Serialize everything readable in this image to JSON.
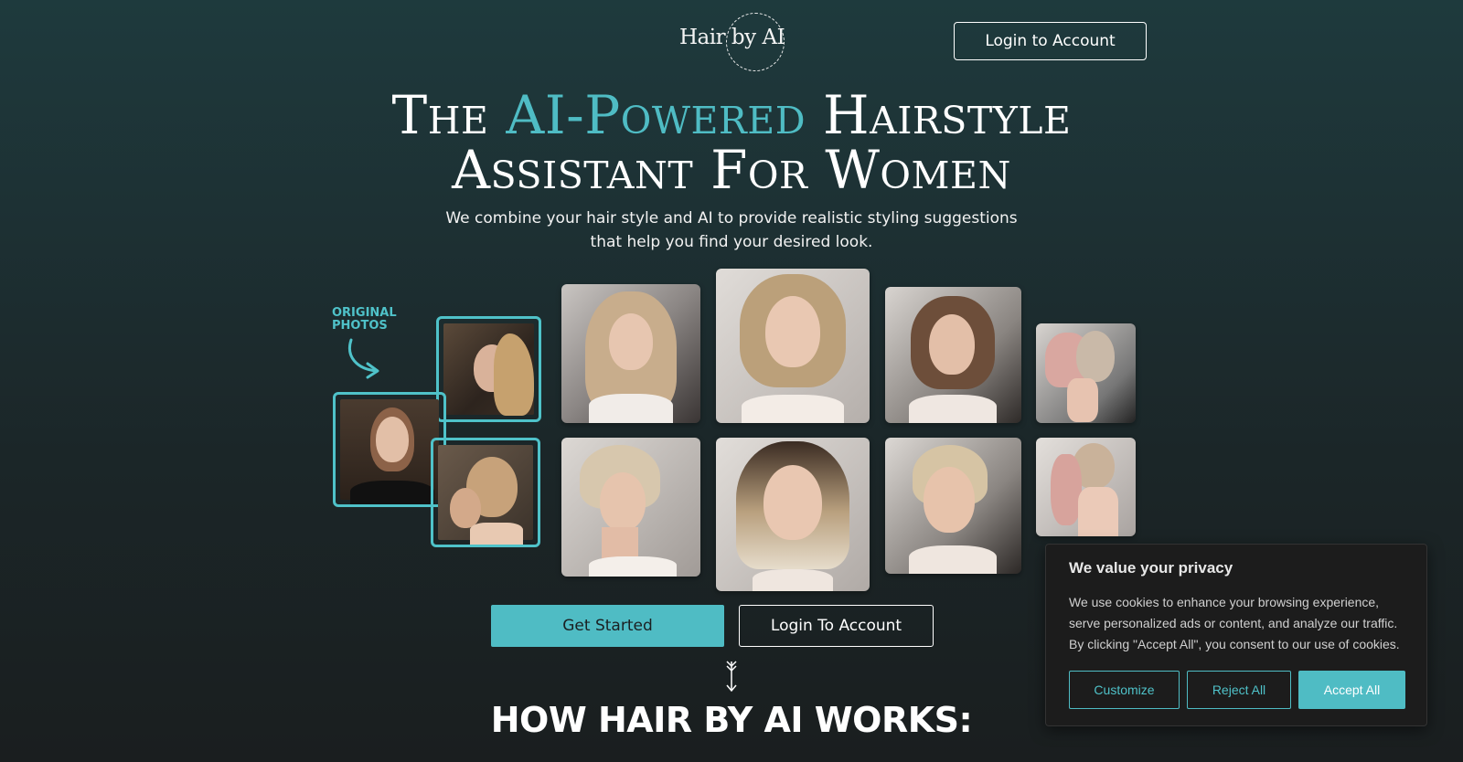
{
  "header": {
    "logo_text": "Hair by AI",
    "login_label": "Login to Account"
  },
  "hero": {
    "title_part1": "The ",
    "title_accent": "AI-Powered",
    "title_part2": " Hairstyle",
    "title_line2": "Assistant For Women",
    "subtitle_line1": "We combine your hair style and AI to provide realistic styling suggestions",
    "subtitle_line2": "that help you find your desired look.",
    "original_label_line1": "ORIGINAL",
    "original_label_line2": "PHOTOS"
  },
  "cta": {
    "get_started": "Get Started",
    "login": "Login To Account"
  },
  "section": {
    "how_title": "HOW HAIR BY AI WORKS:"
  },
  "cookie_banner": {
    "title": "We value your privacy",
    "body": "We use cookies to enhance your browsing experience, serve personalized ads or content, and analyze our traffic. By clicking \"Accept All\", you consent to our use of cookies.",
    "customize": "Customize",
    "reject": "Reject All",
    "accept": "Accept All"
  },
  "colors": {
    "accent": "#4fbcc4",
    "background_top": "#1e3a3d",
    "background_bottom": "#1a1e1f"
  }
}
